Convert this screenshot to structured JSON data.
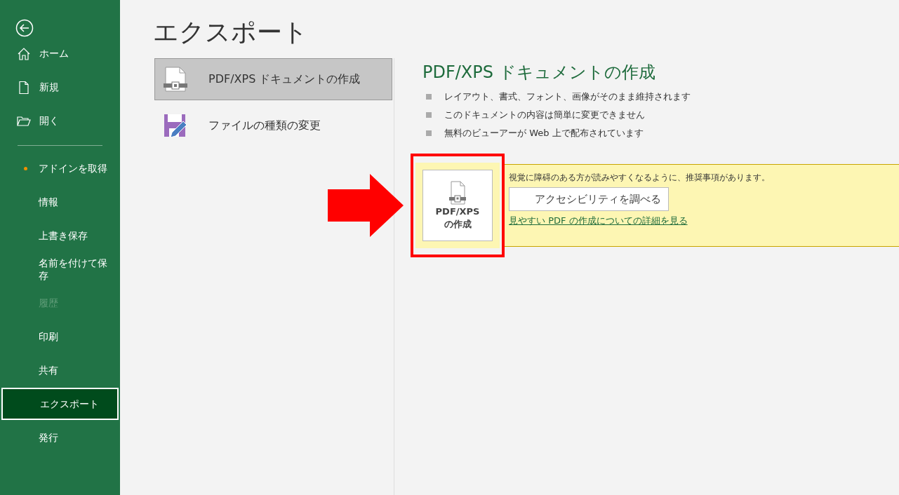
{
  "sidebar": {
    "top_items": [
      {
        "label": "ホーム"
      },
      {
        "label": "新規"
      },
      {
        "label": "開く"
      }
    ],
    "items": [
      {
        "label": "アドインを取得",
        "notification": true,
        "selected": false,
        "disabled": false
      },
      {
        "label": "情報",
        "notification": false,
        "selected": false,
        "disabled": false
      },
      {
        "label": "上書き保存",
        "notification": false,
        "selected": false,
        "disabled": false
      },
      {
        "label": "名前を付けて保存",
        "notification": false,
        "selected": false,
        "disabled": false
      },
      {
        "label": "履歴",
        "notification": false,
        "selected": false,
        "disabled": true
      },
      {
        "label": "印刷",
        "notification": false,
        "selected": false,
        "disabled": false
      },
      {
        "label": "共有",
        "notification": false,
        "selected": false,
        "disabled": false
      },
      {
        "label": "エクスポート",
        "notification": false,
        "selected": true,
        "disabled": false
      },
      {
        "label": "発行",
        "notification": false,
        "selected": false,
        "disabled": false
      }
    ]
  },
  "page_title": "エクスポート",
  "export_options": [
    {
      "label": "PDF/XPS ドキュメントの作成",
      "selected": true
    },
    {
      "label": "ファイルの種類の変更",
      "selected": false
    }
  ],
  "detail": {
    "heading": "PDF/XPS ドキュメントの作成",
    "bullets": [
      "レイアウト、書式、フォント、画像がそのまま維持されます",
      "このドキュメントの内容は簡単に変更できません",
      "無料のビューアーが Web 上で配布されています"
    ],
    "create_button": {
      "line_1": "PDF/XPS",
      "line_2": "の作成"
    },
    "accessibility_message": "視覚に障碍のある方が読みやすくなるように、推奨事項があります。",
    "check_button": "アクセシビリティを調べる",
    "link": "見やすい PDF の作成についての詳細を見る"
  }
}
